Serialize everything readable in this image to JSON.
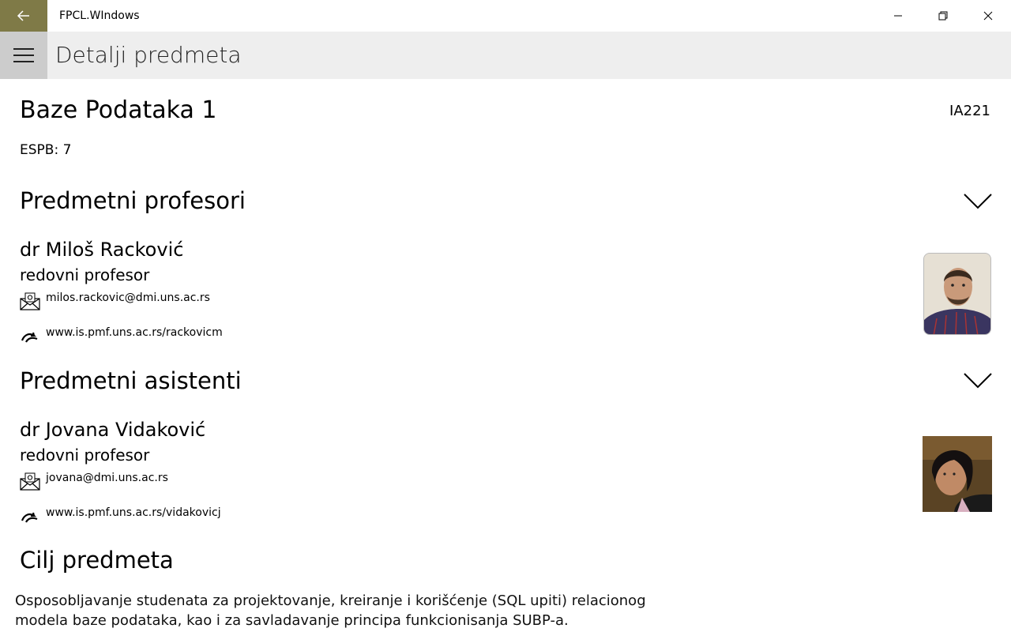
{
  "window": {
    "title": "FPCL.WIndows",
    "controls": [
      "minimize-icon",
      "restore-icon",
      "close-icon"
    ]
  },
  "header": {
    "page_title": "Detalji predmeta"
  },
  "subject": {
    "name": "Baze Podataka 1",
    "code": "IA221",
    "espb_label": "ESPB:",
    "espb_value": "7"
  },
  "professors": {
    "heading": "Predmetni profesori",
    "items": [
      {
        "name": "dr Miloš Racković",
        "role": "redovni profesor",
        "email": "milos.rackovic@dmi.uns.ac.rs",
        "website": "www.is.pmf.uns.ac.rs/rackovicm"
      }
    ]
  },
  "assistants": {
    "heading": "Predmetni asistenti",
    "items": [
      {
        "name": "dr Jovana Vidaković",
        "role": "redovni profesor",
        "email": "jovana@dmi.uns.ac.rs",
        "website": "www.is.pmf.uns.ac.rs/vidakovicj"
      }
    ]
  },
  "goal": {
    "heading": "Cilj predmeta",
    "text": "Osposobljavanje studenata za projektovanje, kreiranje i korišćenje (SQL upiti) relacionog modela baze podataka, kao i za savladavanje principa funkcionisanja SUBP-a."
  },
  "colors": {
    "accent": "#7f7a47",
    "header_bg": "#eeeeee",
    "hamburger_bg": "#cccccc"
  }
}
